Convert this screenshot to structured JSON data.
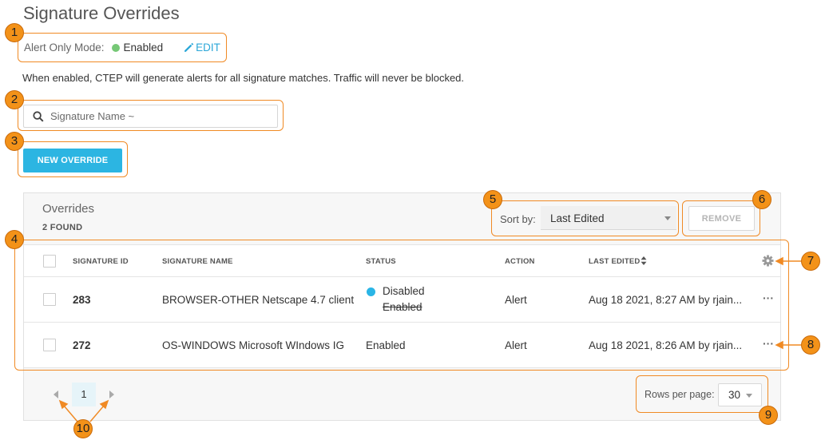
{
  "page": {
    "title": "Signature Overrides"
  },
  "alert_mode": {
    "label": "Alert Only Mode:",
    "value": "Enabled",
    "edit_label": "EDIT"
  },
  "description": "When enabled, CTEP will generate alerts for all signature matches. Traffic will never be blocked.",
  "search": {
    "placeholder": "Signature Name ~"
  },
  "new_override_label": "NEW OVERRIDE",
  "overrides": {
    "title": "Overrides",
    "count_label": "2 FOUND",
    "sort_label": "Sort by:",
    "sort_value": "Last Edited",
    "remove_label": "REMOVE",
    "columns": [
      "SIGNATURE ID",
      "SIGNATURE NAME",
      "STATUS",
      "ACTION",
      "LAST EDITED"
    ],
    "rows": [
      {
        "id": "283",
        "name": "BROWSER-OTHER Netscape 4.7 client",
        "status": "Disabled",
        "status_prev": "Enabled",
        "action": "Alert",
        "last_edited": "Aug 18 2021, 8:27 AM by rjain..."
      },
      {
        "id": "272",
        "name": "OS-WINDOWS Microsoft WIndows IG",
        "status": "Enabled",
        "action": "Alert",
        "last_edited": "Aug 18 2021, 8:26 AM by rjain..."
      }
    ],
    "more_icon": "···"
  },
  "pagination": {
    "current_page": "1",
    "rows_per_page_label": "Rows per page:",
    "rows_per_page_value": "30"
  },
  "annotations": [
    "1",
    "2",
    "3",
    "4",
    "5",
    "6",
    "7",
    "8",
    "9",
    "10"
  ],
  "colors": {
    "accent": "#2cb5e2",
    "annotation": "#f39219",
    "enabled_dot": "#76c876",
    "disabled_dot": "#2ab5e6"
  }
}
